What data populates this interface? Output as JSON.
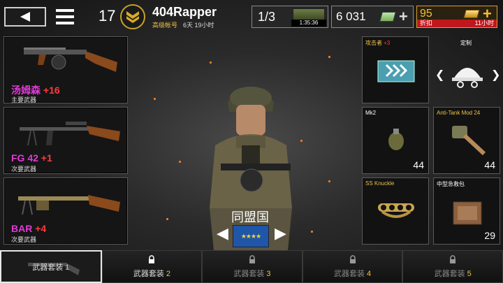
{
  "header": {
    "level": "17",
    "player_name": "404Rapper",
    "account_type": "高级帐号",
    "account_time": "6天 19小时"
  },
  "currency": {
    "supply_count": "1/3",
    "supply_timer": "1:35:36",
    "cash": "6 031",
    "gold": "95",
    "discount_label": "折扣",
    "discount_time": "11小时"
  },
  "weapons": [
    {
      "name": "汤姆森",
      "upgrade": "+16",
      "type": "主要武器"
    },
    {
      "name": "FG 42",
      "upgrade": "+1",
      "type": "次要武器"
    },
    {
      "name": "BAR",
      "upgrade": "+4",
      "type": "次要武器"
    }
  ],
  "gear": {
    "perk_title": "攻击者",
    "perk_level": "+3",
    "custom_label": "定制",
    "items": [
      {
        "name": "Mk2",
        "count": "44"
      },
      {
        "name": "Anti-Tank Mod 24",
        "count": "44"
      },
      {
        "name": "SS Knuckle",
        "count": ""
      },
      {
        "name": "中型急救包",
        "count": "29"
      }
    ]
  },
  "faction": {
    "name": "同盟国"
  },
  "loadouts": [
    {
      "label": "武器套装",
      "num": "1",
      "locked": false
    },
    {
      "label": "武器套装",
      "num": "2",
      "locked": true
    },
    {
      "label": "武器套装",
      "num": "3",
      "locked": true
    },
    {
      "label": "武器套装",
      "num": "4",
      "locked": true
    },
    {
      "label": "武器套装",
      "num": "5",
      "locked": true
    }
  ],
  "colors": {
    "upgrade": "#ff3b3b",
    "weapon_name": "#e03ad6",
    "accent_gold": "#f0c24a",
    "discount_red": "#c0171c"
  }
}
